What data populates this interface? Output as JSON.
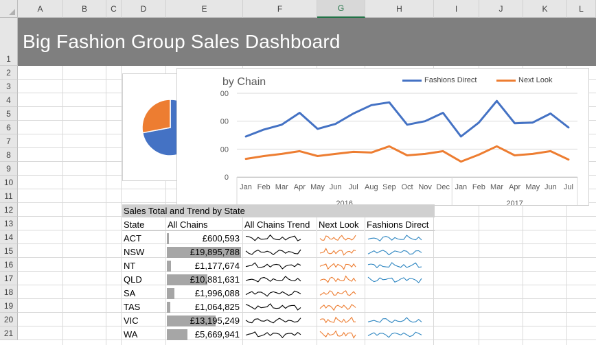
{
  "title": "Big Fashion Group Sales Dashboard",
  "columns": [
    "A",
    "B",
    "C",
    "D",
    "E",
    "F",
    "G",
    "H",
    "I",
    "J",
    "K",
    "L"
  ],
  "selected_column": "G",
  "rows": [
    "1",
    "2",
    "3",
    "4",
    "5",
    "6",
    "7",
    "8",
    "9",
    "10",
    "11",
    "12",
    "13",
    "14",
    "15",
    "16",
    "17",
    "18",
    "19",
    "20",
    "21"
  ],
  "colors": {
    "fashions_direct": "#4472c4",
    "next_look": "#ed7d31",
    "spark_fd": "#2e86c1",
    "databar": "#a6a6a6"
  },
  "chart_data": [
    {
      "type": "pie",
      "series": [
        {
          "values": [
            72,
            28
          ]
        }
      ]
    },
    {
      "type": "line",
      "title": "by Chain",
      "categories": [
        "Jan",
        "Feb",
        "Mar",
        "Apr",
        "May",
        "Jun",
        "Jul",
        "Aug",
        "Sep",
        "Oct",
        "Nov",
        "Dec",
        "Jan",
        "Feb",
        "Mar",
        "Apr",
        "May",
        "Jun",
        "Jul"
      ],
      "groups": [
        {
          "label": "2016"
        },
        {
          "label": "2017"
        }
      ],
      "y_ticks_visible": [
        "00",
        "00",
        "00",
        "0"
      ],
      "ylim": [
        0,
        600
      ],
      "series": [
        {
          "name": "Fashions Direct",
          "values": [
            290,
            340,
            375,
            460,
            345,
            380,
            455,
            515,
            535,
            375,
            400,
            460,
            290,
            390,
            545,
            385,
            390,
            455,
            355
          ]
        },
        {
          "name": "Next Look",
          "values": [
            130,
            150,
            165,
            185,
            150,
            165,
            180,
            175,
            220,
            155,
            165,
            185,
            110,
            160,
            220,
            155,
            165,
            185,
            125
          ]
        }
      ]
    }
  ],
  "table": {
    "title": "Sales Total and Trend by State",
    "headers": [
      "State",
      "All Chains",
      "All Chains Trend",
      "Next Look",
      "Fashions Direct"
    ],
    "rows": [
      {
        "state": "ACT",
        "total": "£600,593",
        "bar": 0.03,
        "fd": true
      },
      {
        "state": "NSW",
        "total": "£19,895,788",
        "bar": 1.0,
        "fd": true
      },
      {
        "state": "NT",
        "total": "£1,177,674",
        "bar": 0.06,
        "fd": true
      },
      {
        "state": "QLD",
        "total": "£10,881,631",
        "bar": 0.55,
        "fd": true
      },
      {
        "state": "SA",
        "total": "£1,996,088",
        "bar": 0.1,
        "fd": false
      },
      {
        "state": "TAS",
        "total": "£1,064,825",
        "bar": 0.05,
        "fd": false
      },
      {
        "state": "VIC",
        "total": "£13,195,249",
        "bar": 0.66,
        "fd": true
      },
      {
        "state": "WA",
        "total": "£5,669,941",
        "bar": 0.28,
        "fd": true
      }
    ]
  }
}
